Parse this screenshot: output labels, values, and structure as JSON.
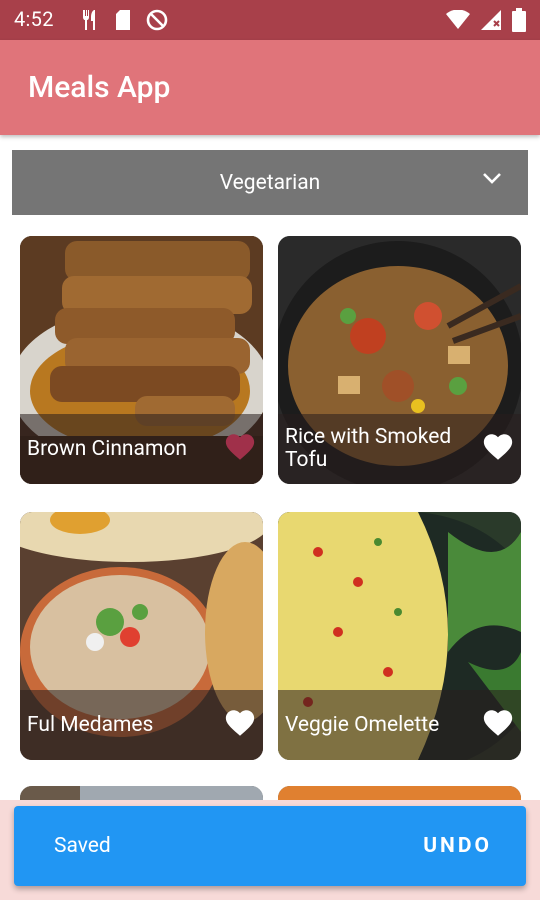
{
  "status_bar": {
    "time": "4:52",
    "icons_left": [
      "fork-knife-icon",
      "sd-card-icon",
      "no-disturb-icon"
    ],
    "icons_right": [
      "wifi-icon",
      "signal-icon",
      "battery-icon"
    ]
  },
  "app_bar": {
    "title": "Meals App",
    "color": "#e0747a"
  },
  "filter": {
    "selected": "Vegetarian"
  },
  "meals": [
    {
      "title": "Brown Cinnamon",
      "favorite": true
    },
    {
      "title": "Rice with Smoked Tofu",
      "favorite": false
    },
    {
      "title": "Ful Medames",
      "favorite": false
    },
    {
      "title": "Veggie Omelette",
      "favorite": false
    }
  ],
  "snackbar": {
    "message": "Saved",
    "action": "UNDO",
    "color": "#2196f3"
  }
}
